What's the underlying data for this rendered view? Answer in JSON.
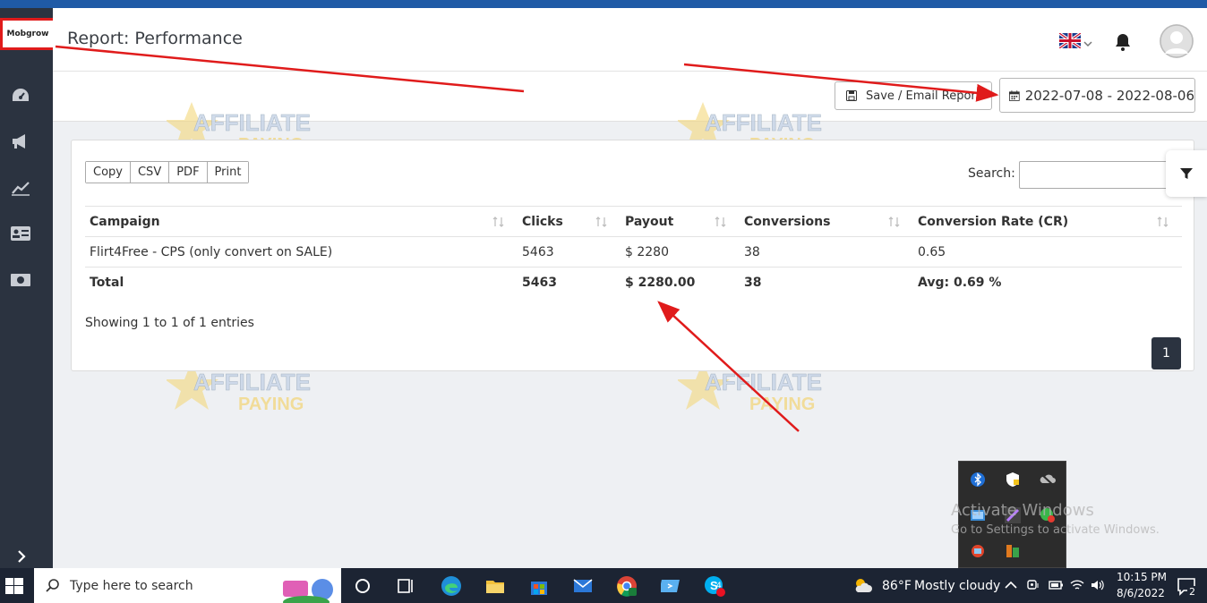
{
  "sidebar": {
    "logo": "Mobgrow",
    "icons": [
      "dashboard-icon",
      "megaphone-icon",
      "chart-line-icon",
      "contact-card-icon",
      "money-icon"
    ],
    "expand_icon": "chevron-right-icon"
  },
  "header": {
    "title": "Report: Performance",
    "language_flag": "uk-flag-icon"
  },
  "toolbar": {
    "save_label": "Save / Email Report",
    "date_range": "2022-07-08 - 2022-08-06"
  },
  "table_controls": {
    "export_buttons": [
      "Copy",
      "CSV",
      "PDF",
      "Print"
    ],
    "search_label": "Search:",
    "search_value": ""
  },
  "table": {
    "columns": [
      "Campaign",
      "Clicks",
      "Payout",
      "Conversions",
      "Conversion Rate (CR)"
    ],
    "rows": [
      [
        "Flirt4Free - CPS (only convert on SALE)",
        "5463",
        "$ 2280",
        "38",
        "0.65"
      ]
    ],
    "total": [
      "Total",
      "5463",
      "$ 2280.00",
      "38",
      "Avg: 0.69 %"
    ]
  },
  "pagination": {
    "info": "Showing 1 to 1 of 1 entries",
    "current_page": "1"
  },
  "watermark": {
    "line1": "AFFILIATE",
    "line2": "PAYING"
  },
  "activate_windows": {
    "title": "Activate Windows",
    "subtitle": "Go to Settings to activate Windows."
  },
  "taskbar": {
    "search_placeholder": "Type here to search",
    "weather_temp": "86°F",
    "weather_desc": "Mostly cloudy",
    "time": "10:15 PM",
    "date": "8/6/2022",
    "notification_count": "2",
    "skype_badge": "4"
  },
  "colors": {
    "sidebar": "#2b3340",
    "link": "#1a6fd0",
    "annotation": "#e01b1b",
    "taskbar": "#1c2433"
  }
}
